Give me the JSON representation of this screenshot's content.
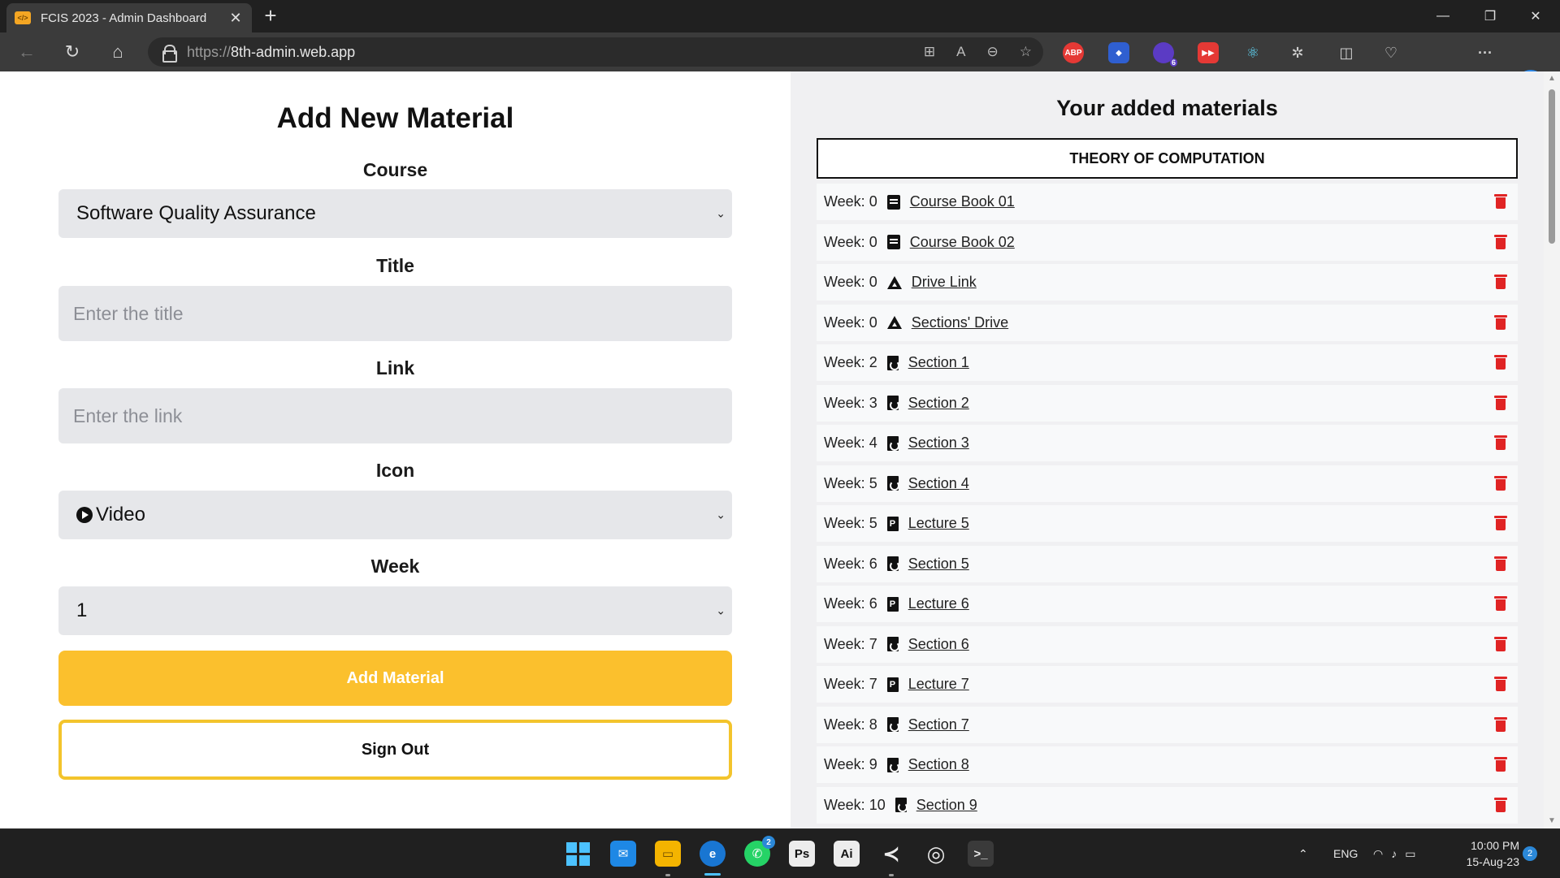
{
  "browser": {
    "tab_title": "FCIS 2023 - Admin Dashboard",
    "tab_favicon": "code-icon",
    "url_scheme": "https://",
    "url_host": "8th-admin.web.app",
    "extension_badge": "6"
  },
  "form": {
    "title": "Add New Material",
    "course_label": "Course",
    "course_value": "Software Quality Assurance",
    "title_label": "Title",
    "title_placeholder": "Enter the title",
    "link_label": "Link",
    "link_placeholder": "Enter the link",
    "icon_label": "Icon",
    "icon_value": "Video",
    "week_label": "Week",
    "week_value": "1",
    "add_button": "Add Material",
    "signout_button": "Sign Out",
    "accent_color": "#fbc02d"
  },
  "materials": {
    "heading": "Your added materials",
    "course": "THEORY OF COMPUTATION",
    "items": [
      {
        "week": "Week: 0",
        "icon": "book-icon",
        "label": "Course Book 01"
      },
      {
        "week": "Week: 0",
        "icon": "book-icon",
        "label": "Course Book 02"
      },
      {
        "week": "Week: 0",
        "icon": "drive-icon",
        "label": "Drive Link"
      },
      {
        "week": "Week: 0",
        "icon": "drive-icon",
        "label": "Sections' Drive"
      },
      {
        "week": "Week: 2",
        "icon": "pdf-icon",
        "label": "Section 1"
      },
      {
        "week": "Week: 3",
        "icon": "pdf-icon",
        "label": "Section 2"
      },
      {
        "week": "Week: 4",
        "icon": "pdf-icon",
        "label": "Section 3"
      },
      {
        "week": "Week: 5",
        "icon": "pdf-icon",
        "label": "Section 4"
      },
      {
        "week": "Week: 5",
        "icon": "powerpoint-icon",
        "label": "Lecture 5"
      },
      {
        "week": "Week: 6",
        "icon": "pdf-icon",
        "label": "Section 5"
      },
      {
        "week": "Week: 6",
        "icon": "powerpoint-icon",
        "label": "Lecture 6"
      },
      {
        "week": "Week: 7",
        "icon": "pdf-icon",
        "label": "Section 6"
      },
      {
        "week": "Week: 7",
        "icon": "powerpoint-icon",
        "label": "Lecture 7"
      },
      {
        "week": "Week: 8",
        "icon": "pdf-icon",
        "label": "Section 7"
      },
      {
        "week": "Week: 9",
        "icon": "pdf-icon",
        "label": "Section 8"
      },
      {
        "week": "Week: 10",
        "icon": "pdf-icon",
        "label": "Section 9"
      }
    ],
    "delete_color": "#e02424"
  },
  "taskbar": {
    "whatsapp_badge": "2",
    "language": "ENG",
    "time": "10:00 PM",
    "date": "15-Aug-23",
    "notifications": "2"
  }
}
